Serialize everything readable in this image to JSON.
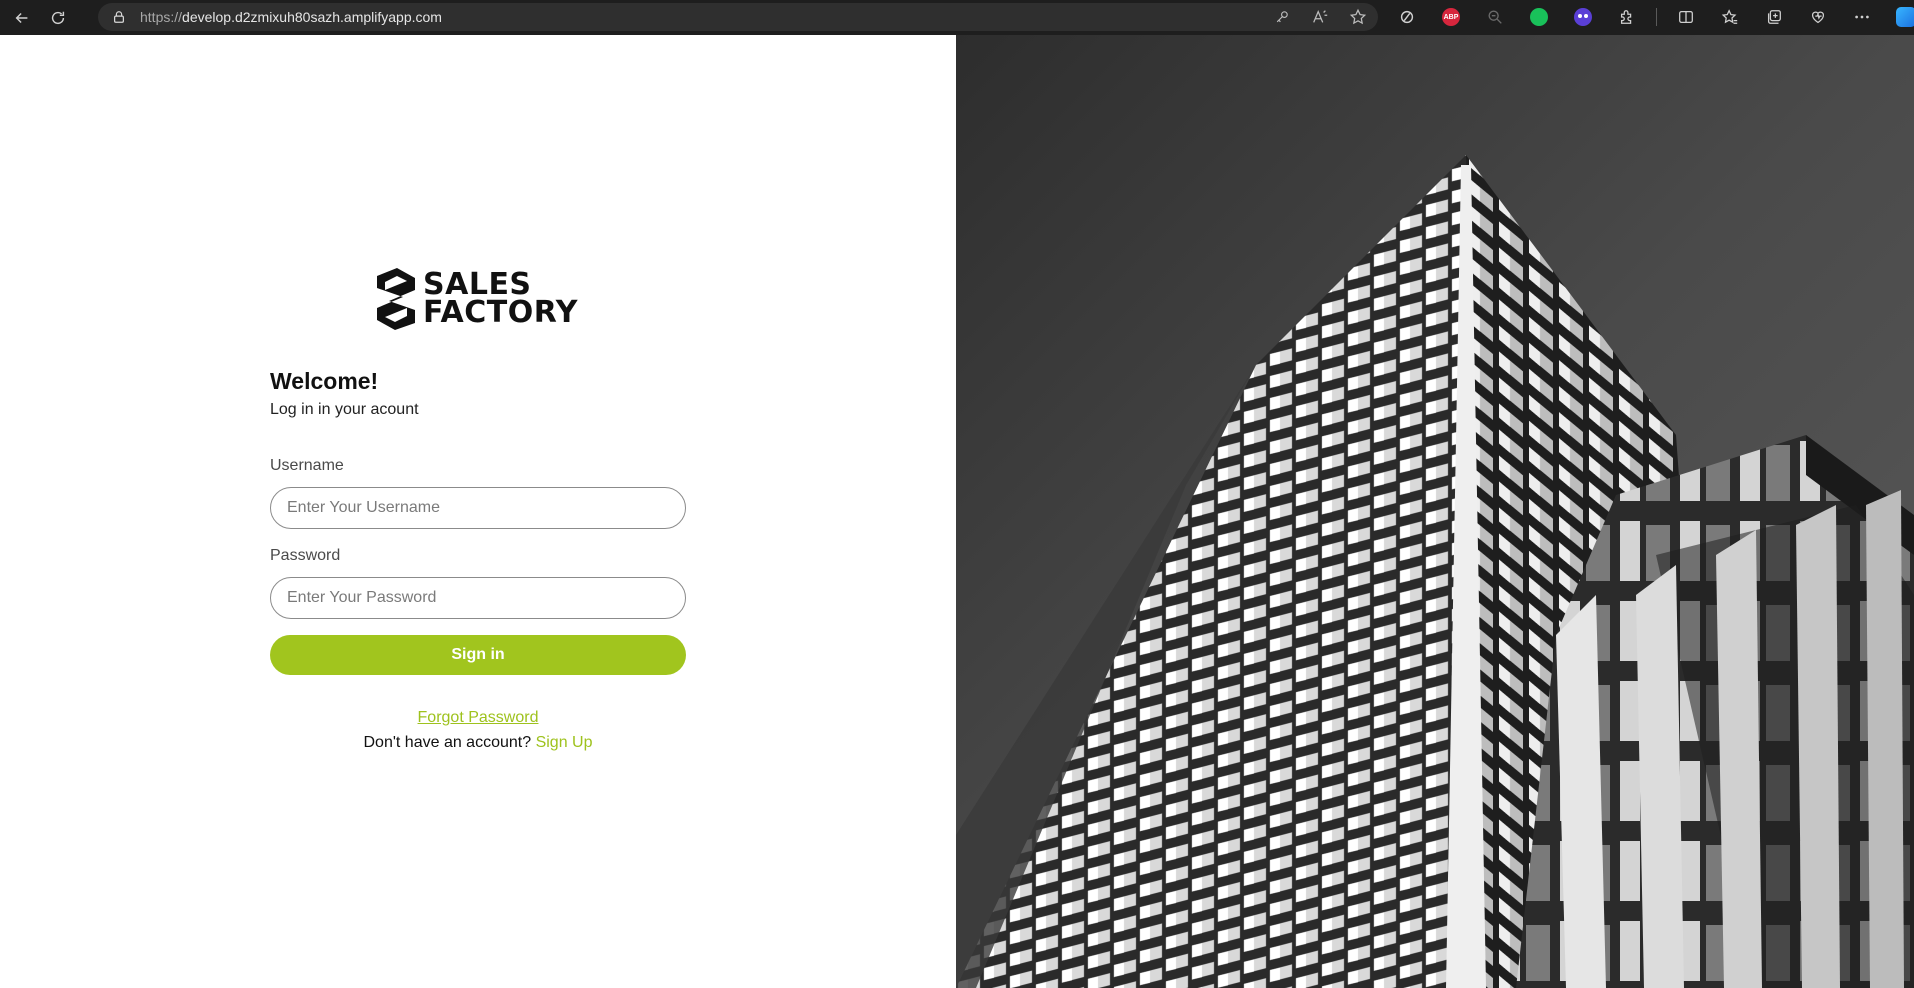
{
  "browser": {
    "url_scheme": "https://",
    "url_host": "develop.d2zmixuh80sazh.amplifyapp.com",
    "abp_label": "ABP"
  },
  "login": {
    "logo_line1": "SALES",
    "logo_line2": "FACTORY",
    "welcome": "Welcome!",
    "subtitle": "Log in in your acount",
    "username_label": "Username",
    "username_placeholder": "Enter Your Username",
    "password_label": "Password",
    "password_placeholder": "Enter Your Password",
    "signin_label": "Sign in",
    "forgot_label": "Forgot Password",
    "no_account_text": "Don't have an account?",
    "signup_label": "Sign Up"
  },
  "colors": {
    "accent": "#a1c51e",
    "link": "#9ec21d",
    "chrome_bg": "#1e1e1e"
  }
}
